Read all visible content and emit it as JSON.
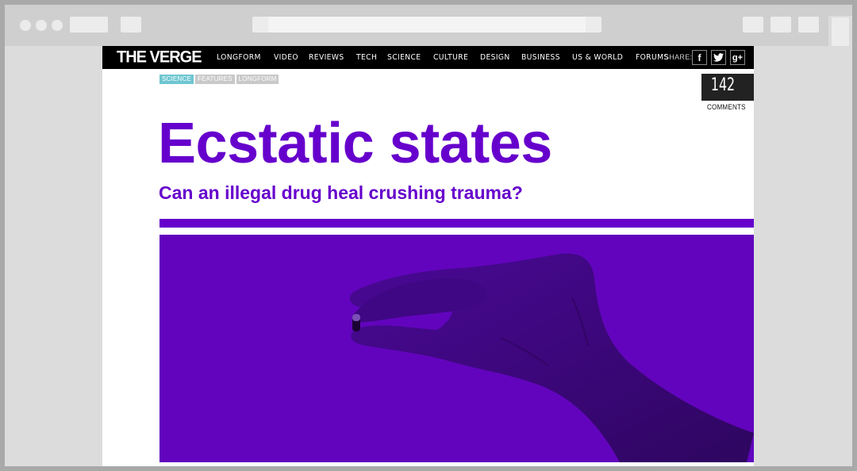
{
  "site": {
    "logo": "THE VERGE",
    "nav": [
      "LONGFORM",
      "VIDEO",
      "REVIEWS",
      "TECH",
      "SCIENCE",
      "CULTURE",
      "DESIGN",
      "BUSINESS",
      "US & WORLD",
      "FORUMS"
    ],
    "share_label": "SHARE:",
    "share_icons": [
      "facebook-icon",
      "twitter-icon",
      "google-plus-icon"
    ],
    "share_glyphs": [
      "f",
      "t",
      "g+"
    ]
  },
  "article": {
    "tags": [
      "SCIENCE",
      "FEATURES",
      "LONGFORM"
    ],
    "comments_count": "142",
    "comments_label": "COMMENTS",
    "title": "Ecstatic states",
    "subtitle": "Can an illegal drug heal crushing trauma?"
  },
  "colors": {
    "accent": "#6600cc",
    "nav_bg": "#000000",
    "science_tag": "#6ec6d1",
    "comment_flag": "#ff5a36"
  }
}
